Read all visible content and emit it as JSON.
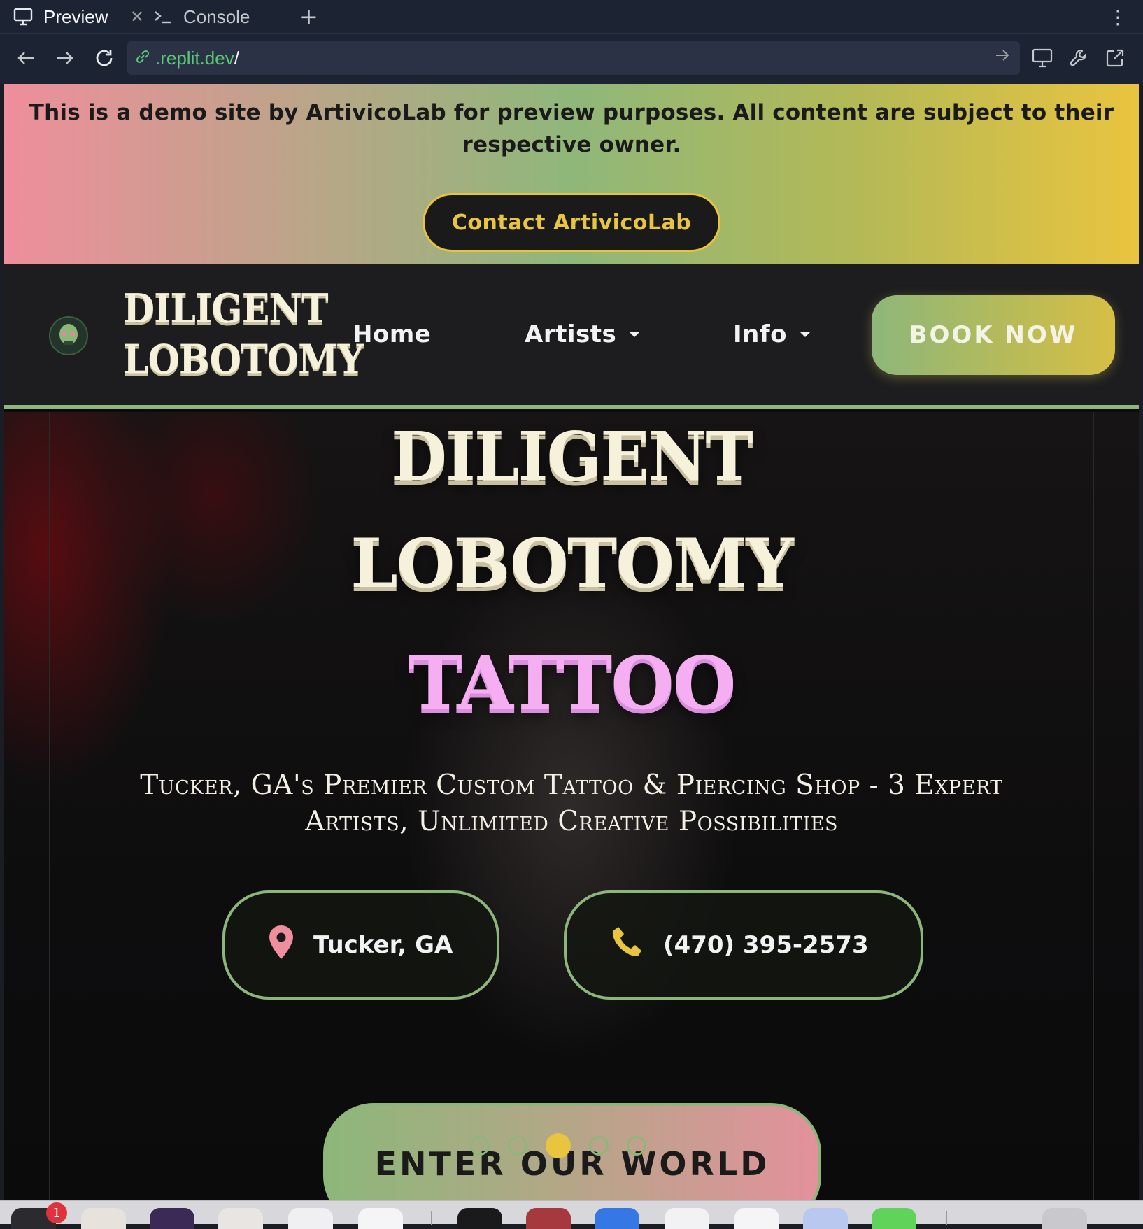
{
  "browser": {
    "tabs": [
      {
        "label": "Preview",
        "icon": "monitor-icon",
        "active": true
      },
      {
        "label": "Console",
        "icon": "terminal-icon",
        "active": false
      }
    ],
    "url_host": ".replit.dev",
    "url_path": "/"
  },
  "demo_banner": {
    "text": "This is a demo site by ArtivicoLab for preview purposes. All content are subject to their respective owner.",
    "button": "Contact ArtivicoLab"
  },
  "nav": {
    "logo_line1": "DILIGENT",
    "logo_line2": "LOBOTOMY",
    "links": [
      {
        "label": "Home",
        "has_dropdown": false
      },
      {
        "label": "Artists",
        "has_dropdown": true
      },
      {
        "label": "Info",
        "has_dropdown": true
      }
    ],
    "cta": "BOOK NOW"
  },
  "hero": {
    "title_line1": "DILIGENT",
    "title_line2": "LOBOTOMY",
    "title_line3": "TATTOO",
    "tagline": "Tucker, GA's Premier Custom Tattoo & Piercing Shop - 3 Expert Artists, Unlimited Creative Possibilities",
    "location": "Tucker, GA",
    "phone": "(470) 395-2573",
    "cta": "ENTER OUR WORLD",
    "slide_count": 5,
    "active_slide": 3
  },
  "colors": {
    "accent_green": "#8db77a",
    "accent_yellow": "#e9c43f",
    "accent_pink": "#ef8e9c",
    "title_cream": "#f6f1da",
    "title_pink": "#f5aef2"
  },
  "dock": {
    "badge_count": "1"
  }
}
